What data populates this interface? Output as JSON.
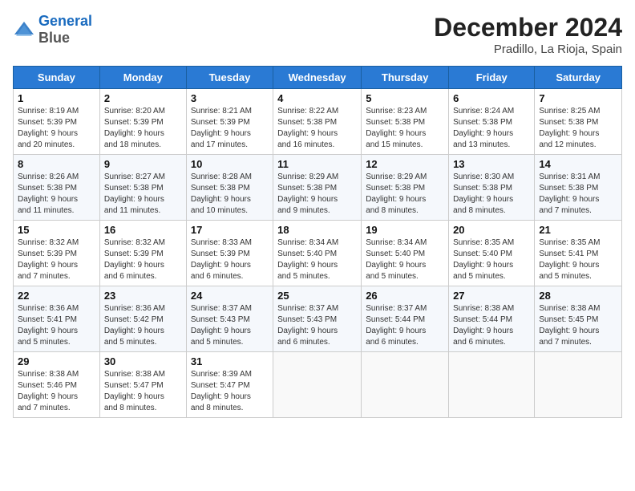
{
  "header": {
    "logo_line1": "General",
    "logo_line2": "Blue",
    "month": "December 2024",
    "location": "Pradillo, La Rioja, Spain"
  },
  "days_of_week": [
    "Sunday",
    "Monday",
    "Tuesday",
    "Wednesday",
    "Thursday",
    "Friday",
    "Saturday"
  ],
  "weeks": [
    [
      {
        "day": "1",
        "info": "Sunrise: 8:19 AM\nSunset: 5:39 PM\nDaylight: 9 hours\nand 20 minutes."
      },
      {
        "day": "2",
        "info": "Sunrise: 8:20 AM\nSunset: 5:39 PM\nDaylight: 9 hours\nand 18 minutes."
      },
      {
        "day": "3",
        "info": "Sunrise: 8:21 AM\nSunset: 5:39 PM\nDaylight: 9 hours\nand 17 minutes."
      },
      {
        "day": "4",
        "info": "Sunrise: 8:22 AM\nSunset: 5:38 PM\nDaylight: 9 hours\nand 16 minutes."
      },
      {
        "day": "5",
        "info": "Sunrise: 8:23 AM\nSunset: 5:38 PM\nDaylight: 9 hours\nand 15 minutes."
      },
      {
        "day": "6",
        "info": "Sunrise: 8:24 AM\nSunset: 5:38 PM\nDaylight: 9 hours\nand 13 minutes."
      },
      {
        "day": "7",
        "info": "Sunrise: 8:25 AM\nSunset: 5:38 PM\nDaylight: 9 hours\nand 12 minutes."
      }
    ],
    [
      {
        "day": "8",
        "info": "Sunrise: 8:26 AM\nSunset: 5:38 PM\nDaylight: 9 hours\nand 11 minutes."
      },
      {
        "day": "9",
        "info": "Sunrise: 8:27 AM\nSunset: 5:38 PM\nDaylight: 9 hours\nand 11 minutes."
      },
      {
        "day": "10",
        "info": "Sunrise: 8:28 AM\nSunset: 5:38 PM\nDaylight: 9 hours\nand 10 minutes."
      },
      {
        "day": "11",
        "info": "Sunrise: 8:29 AM\nSunset: 5:38 PM\nDaylight: 9 hours\nand 9 minutes."
      },
      {
        "day": "12",
        "info": "Sunrise: 8:29 AM\nSunset: 5:38 PM\nDaylight: 9 hours\nand 8 minutes."
      },
      {
        "day": "13",
        "info": "Sunrise: 8:30 AM\nSunset: 5:38 PM\nDaylight: 9 hours\nand 8 minutes."
      },
      {
        "day": "14",
        "info": "Sunrise: 8:31 AM\nSunset: 5:38 PM\nDaylight: 9 hours\nand 7 minutes."
      }
    ],
    [
      {
        "day": "15",
        "info": "Sunrise: 8:32 AM\nSunset: 5:39 PM\nDaylight: 9 hours\nand 7 minutes."
      },
      {
        "day": "16",
        "info": "Sunrise: 8:32 AM\nSunset: 5:39 PM\nDaylight: 9 hours\nand 6 minutes."
      },
      {
        "day": "17",
        "info": "Sunrise: 8:33 AM\nSunset: 5:39 PM\nDaylight: 9 hours\nand 6 minutes."
      },
      {
        "day": "18",
        "info": "Sunrise: 8:34 AM\nSunset: 5:40 PM\nDaylight: 9 hours\nand 5 minutes."
      },
      {
        "day": "19",
        "info": "Sunrise: 8:34 AM\nSunset: 5:40 PM\nDaylight: 9 hours\nand 5 minutes."
      },
      {
        "day": "20",
        "info": "Sunrise: 8:35 AM\nSunset: 5:40 PM\nDaylight: 9 hours\nand 5 minutes."
      },
      {
        "day": "21",
        "info": "Sunrise: 8:35 AM\nSunset: 5:41 PM\nDaylight: 9 hours\nand 5 minutes."
      }
    ],
    [
      {
        "day": "22",
        "info": "Sunrise: 8:36 AM\nSunset: 5:41 PM\nDaylight: 9 hours\nand 5 minutes."
      },
      {
        "day": "23",
        "info": "Sunrise: 8:36 AM\nSunset: 5:42 PM\nDaylight: 9 hours\nand 5 minutes."
      },
      {
        "day": "24",
        "info": "Sunrise: 8:37 AM\nSunset: 5:43 PM\nDaylight: 9 hours\nand 5 minutes."
      },
      {
        "day": "25",
        "info": "Sunrise: 8:37 AM\nSunset: 5:43 PM\nDaylight: 9 hours\nand 6 minutes."
      },
      {
        "day": "26",
        "info": "Sunrise: 8:37 AM\nSunset: 5:44 PM\nDaylight: 9 hours\nand 6 minutes."
      },
      {
        "day": "27",
        "info": "Sunrise: 8:38 AM\nSunset: 5:44 PM\nDaylight: 9 hours\nand 6 minutes."
      },
      {
        "day": "28",
        "info": "Sunrise: 8:38 AM\nSunset: 5:45 PM\nDaylight: 9 hours\nand 7 minutes."
      }
    ],
    [
      {
        "day": "29",
        "info": "Sunrise: 8:38 AM\nSunset: 5:46 PM\nDaylight: 9 hours\nand 7 minutes."
      },
      {
        "day": "30",
        "info": "Sunrise: 8:38 AM\nSunset: 5:47 PM\nDaylight: 9 hours\nand 8 minutes."
      },
      {
        "day": "31",
        "info": "Sunrise: 8:39 AM\nSunset: 5:47 PM\nDaylight: 9 hours\nand 8 minutes."
      },
      {
        "day": "",
        "info": ""
      },
      {
        "day": "",
        "info": ""
      },
      {
        "day": "",
        "info": ""
      },
      {
        "day": "",
        "info": ""
      }
    ]
  ]
}
